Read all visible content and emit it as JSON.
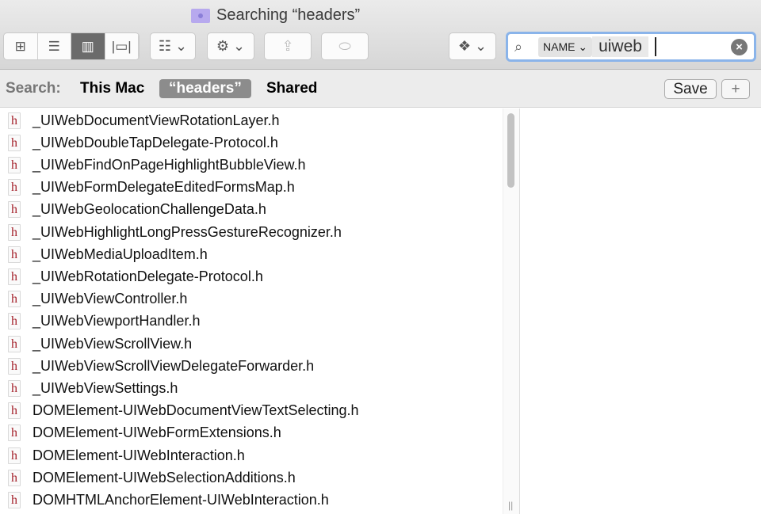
{
  "window": {
    "title": "Searching “headers”"
  },
  "toolbar": {
    "view_modes": [
      "icon-view",
      "list-view",
      "column-view",
      "cover-flow-view"
    ],
    "active_view": "column-view"
  },
  "search": {
    "token": "NAME",
    "value": "uiweb"
  },
  "scope": {
    "label": "Search:",
    "options": [
      "This Mac",
      "“headers”",
      "Shared"
    ],
    "selected": "“headers”",
    "save_label": "Save",
    "add_label": "+"
  },
  "files": [
    "_UIWebDocumentViewRotationLayer.h",
    "_UIWebDoubleTapDelegate-Protocol.h",
    "_UIWebFindOnPageHighlightBubbleView.h",
    "_UIWebFormDelegateEditedFormsMap.h",
    "_UIWebGeolocationChallengeData.h",
    "_UIWebHighlightLongPressGestureRecognizer.h",
    "_UIWebMediaUploadItem.h",
    "_UIWebRotationDelegate-Protocol.h",
    "_UIWebViewController.h",
    "_UIWebViewportHandler.h",
    "_UIWebViewScrollView.h",
    "_UIWebViewScrollViewDelegateForwarder.h",
    "_UIWebViewSettings.h",
    "DOMElement-UIWebDocumentViewTextSelecting.h",
    "DOMElement-UIWebFormExtensions.h",
    "DOMElement-UIWebInteraction.h",
    "DOMElement-UIWebSelectionAdditions.h",
    "DOMHTMLAnchorElement-UIWebInteraction.h"
  ],
  "file_icon_glyph": "h"
}
